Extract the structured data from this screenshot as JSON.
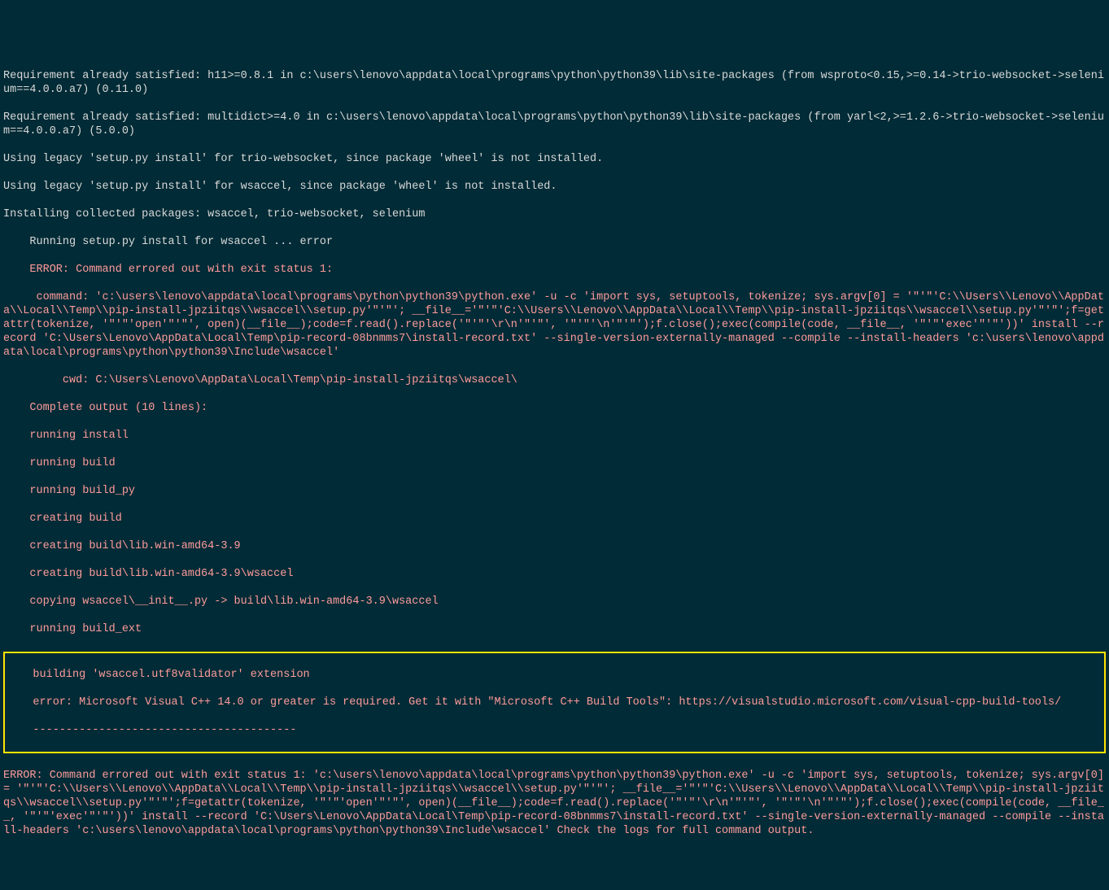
{
  "lines": {
    "l1": "Requirement already satisfied: h11>=0.8.1 in c:\\users\\lenovo\\appdata\\local\\programs\\python\\python39\\lib\\site-packages (from wsproto<0.15,>=0.14->trio-websocket->selenium==4.0.0.a7) (0.11.0)",
    "l2": "Requirement already satisfied: multidict>=4.0 in c:\\users\\lenovo\\appdata\\local\\programs\\python\\python39\\lib\\site-packages (from yarl<2,>=1.2.6->trio-websocket->selenium==4.0.0.a7) (5.0.0)",
    "l3": "Using legacy 'setup.py install' for trio-websocket, since package 'wheel' is not installed.",
    "l4": "Using legacy 'setup.py install' for wsaccel, since package 'wheel' is not installed.",
    "l5": "Installing collected packages: wsaccel, trio-websocket, selenium",
    "l6": "    Running setup.py install for wsaccel ... error",
    "l7": "    ERROR: Command errored out with exit status 1:",
    "l8": "     command: 'c:\\users\\lenovo\\appdata\\local\\programs\\python\\python39\\python.exe' -u -c 'import sys, setuptools, tokenize; sys.argv[0] = '\"'\"'C:\\\\Users\\\\Lenovo\\\\AppData\\\\Local\\\\Temp\\\\pip-install-jpziitqs\\\\wsaccel\\\\setup.py'\"'\"'; __file__='\"'\"'C:\\\\Users\\\\Lenovo\\\\AppData\\\\Local\\\\Temp\\\\pip-install-jpziitqs\\\\wsaccel\\\\setup.py'\"'\"';f=getattr(tokenize, '\"'\"'open'\"'\"', open)(__file__);code=f.read().replace('\"'\"'\\r\\n'\"'\"', '\"'\"'\\n'\"'\"');f.close();exec(compile(code, __file__, '\"'\"'exec'\"'\"'))' install --record 'C:\\Users\\Lenovo\\AppData\\Local\\Temp\\pip-record-08bnmms7\\install-record.txt' --single-version-externally-managed --compile --install-headers 'c:\\users\\lenovo\\appdata\\local\\programs\\python\\python39\\Include\\wsaccel'",
    "l9": "         cwd: C:\\Users\\Lenovo\\AppData\\Local\\Temp\\pip-install-jpziitqs\\wsaccel\\",
    "l10": "    Complete output (10 lines):",
    "l11": "    running install",
    "l12": "    running build",
    "l13": "    running build_py",
    "l14": "    creating build",
    "l15": "    creating build\\lib.win-amd64-3.9",
    "l16": "    creating build\\lib.win-amd64-3.9\\wsaccel",
    "l17": "    copying wsaccel\\__init__.py -> build\\lib.win-amd64-3.9\\wsaccel",
    "l18": "    running build_ext",
    "h1": "    building 'wsaccel.utf8validator' extension",
    "h2": "    error: Microsoft Visual C++ 14.0 or greater is required. Get it with \"Microsoft C++ Build Tools\": https://visualstudio.microsoft.com/visual-cpp-build-tools/",
    "h3": "    ----------------------------------------",
    "l19": "ERROR: Command errored out with exit status 1: 'c:\\users\\lenovo\\appdata\\local\\programs\\python\\python39\\python.exe' -u -c 'import sys, setuptools, tokenize; sys.argv[0] = '\"'\"'C:\\\\Users\\\\Lenovo\\\\AppData\\\\Local\\\\Temp\\\\pip-install-jpziitqs\\\\wsaccel\\\\setup.py'\"'\"'; __file__='\"'\"'C:\\\\Users\\\\Lenovo\\\\AppData\\\\Local\\\\Temp\\\\pip-install-jpziitqs\\\\wsaccel\\\\setup.py'\"'\"';f=getattr(tokenize, '\"'\"'open'\"'\"', open)(__file__);code=f.read().replace('\"'\"'\\r\\n'\"'\"', '\"'\"'\\n'\"'\"');f.close();exec(compile(code, __file__, '\"'\"'exec'\"'\"'))' install --record 'C:\\Users\\Lenovo\\AppData\\Local\\Temp\\pip-record-08bnmms7\\install-record.txt' --single-version-externally-managed --compile --install-headers 'c:\\users\\lenovo\\appdata\\local\\programs\\python\\python39\\Include\\wsaccel' Check the logs for full command output."
  }
}
